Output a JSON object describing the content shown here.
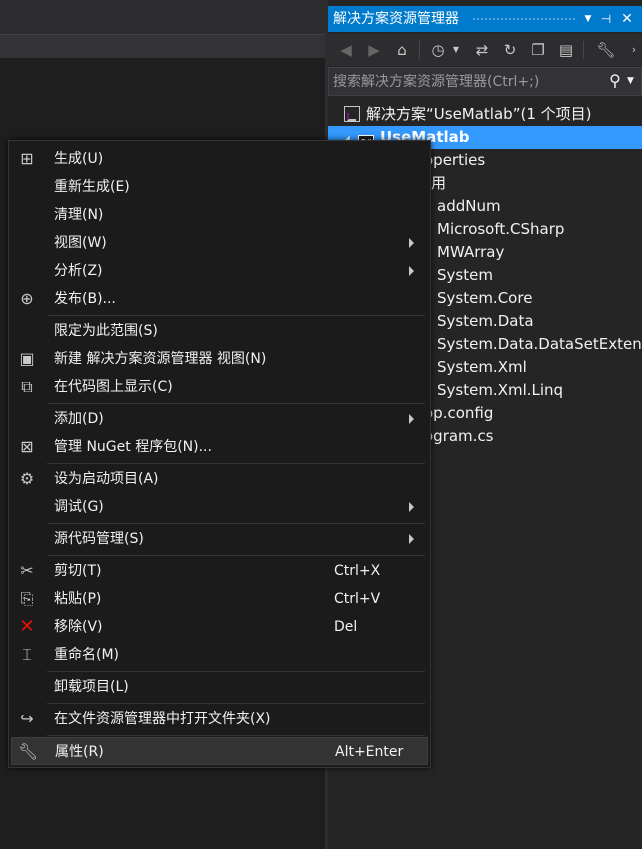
{
  "solution_explorer": {
    "title": "解决方案资源管理器",
    "search_placeholder": "搜索解决方案资源管理器(Ctrl+;)",
    "tree": [
      {
        "label": "解决方案“UseMatlab”(1 个项目)"
      },
      {
        "label": "UseMatlab"
      },
      {
        "label": "operties"
      },
      {
        "label": "用"
      },
      {
        "label": "addNum"
      },
      {
        "label": "Microsoft.CSharp"
      },
      {
        "label": "MWArray"
      },
      {
        "label": "System"
      },
      {
        "label": "System.Core"
      },
      {
        "label": "System.Data"
      },
      {
        "label": "System.Data.DataSetExtensions"
      },
      {
        "label": "System.Xml"
      },
      {
        "label": "System.Xml.Linq"
      },
      {
        "label": "op.config"
      },
      {
        "label": "ogram.cs"
      }
    ],
    "colors": {
      "title_bar": "#007acc",
      "selection": "#3399ff",
      "background": "#252526"
    }
  },
  "context_menu": {
    "items": [
      {
        "label": "生成(U)",
        "icon": "build-icon"
      },
      {
        "label": "重新生成(E)"
      },
      {
        "label": "清理(N)"
      },
      {
        "label": "视图(W)",
        "submenu": true
      },
      {
        "label": "分析(Z)",
        "submenu": true
      },
      {
        "label": "发布(B)...",
        "icon": "publish-icon"
      },
      {
        "label": "限定为此范围(S)"
      },
      {
        "label": "新建 解决方案资源管理器 视图(N)",
        "icon": "new-view-icon"
      },
      {
        "label": "在代码图上显示(C)",
        "icon": "code-map-icon"
      },
      {
        "label": "添加(D)",
        "submenu": true
      },
      {
        "label": "管理 NuGet 程序包(N)...",
        "icon": "nuget-icon"
      },
      {
        "label": "设为启动项目(A)",
        "icon": "gear-icon"
      },
      {
        "label": "调试(G)",
        "submenu": true
      },
      {
        "label": "源代码管理(S)",
        "submenu": true
      },
      {
        "label": "剪切(T)",
        "shortcut": "Ctrl+X",
        "icon": "scissors-icon"
      },
      {
        "label": "粘贴(P)",
        "shortcut": "Ctrl+V",
        "icon": "paste-icon"
      },
      {
        "label": "移除(V)",
        "shortcut": "Del",
        "icon": "remove-icon"
      },
      {
        "label": "重命名(M)",
        "icon": "rename-icon"
      },
      {
        "label": "卸载项目(L)"
      },
      {
        "label": "在文件资源管理器中打开文件夹(X)",
        "icon": "open-folder-icon"
      },
      {
        "label": "属性(R)",
        "shortcut": "Alt+Enter",
        "icon": "wrench-icon",
        "highlighted": true
      }
    ],
    "colors": {
      "background": "#1b1b1c",
      "highlight": "#333334",
      "remove_icon": "#e51400"
    }
  }
}
